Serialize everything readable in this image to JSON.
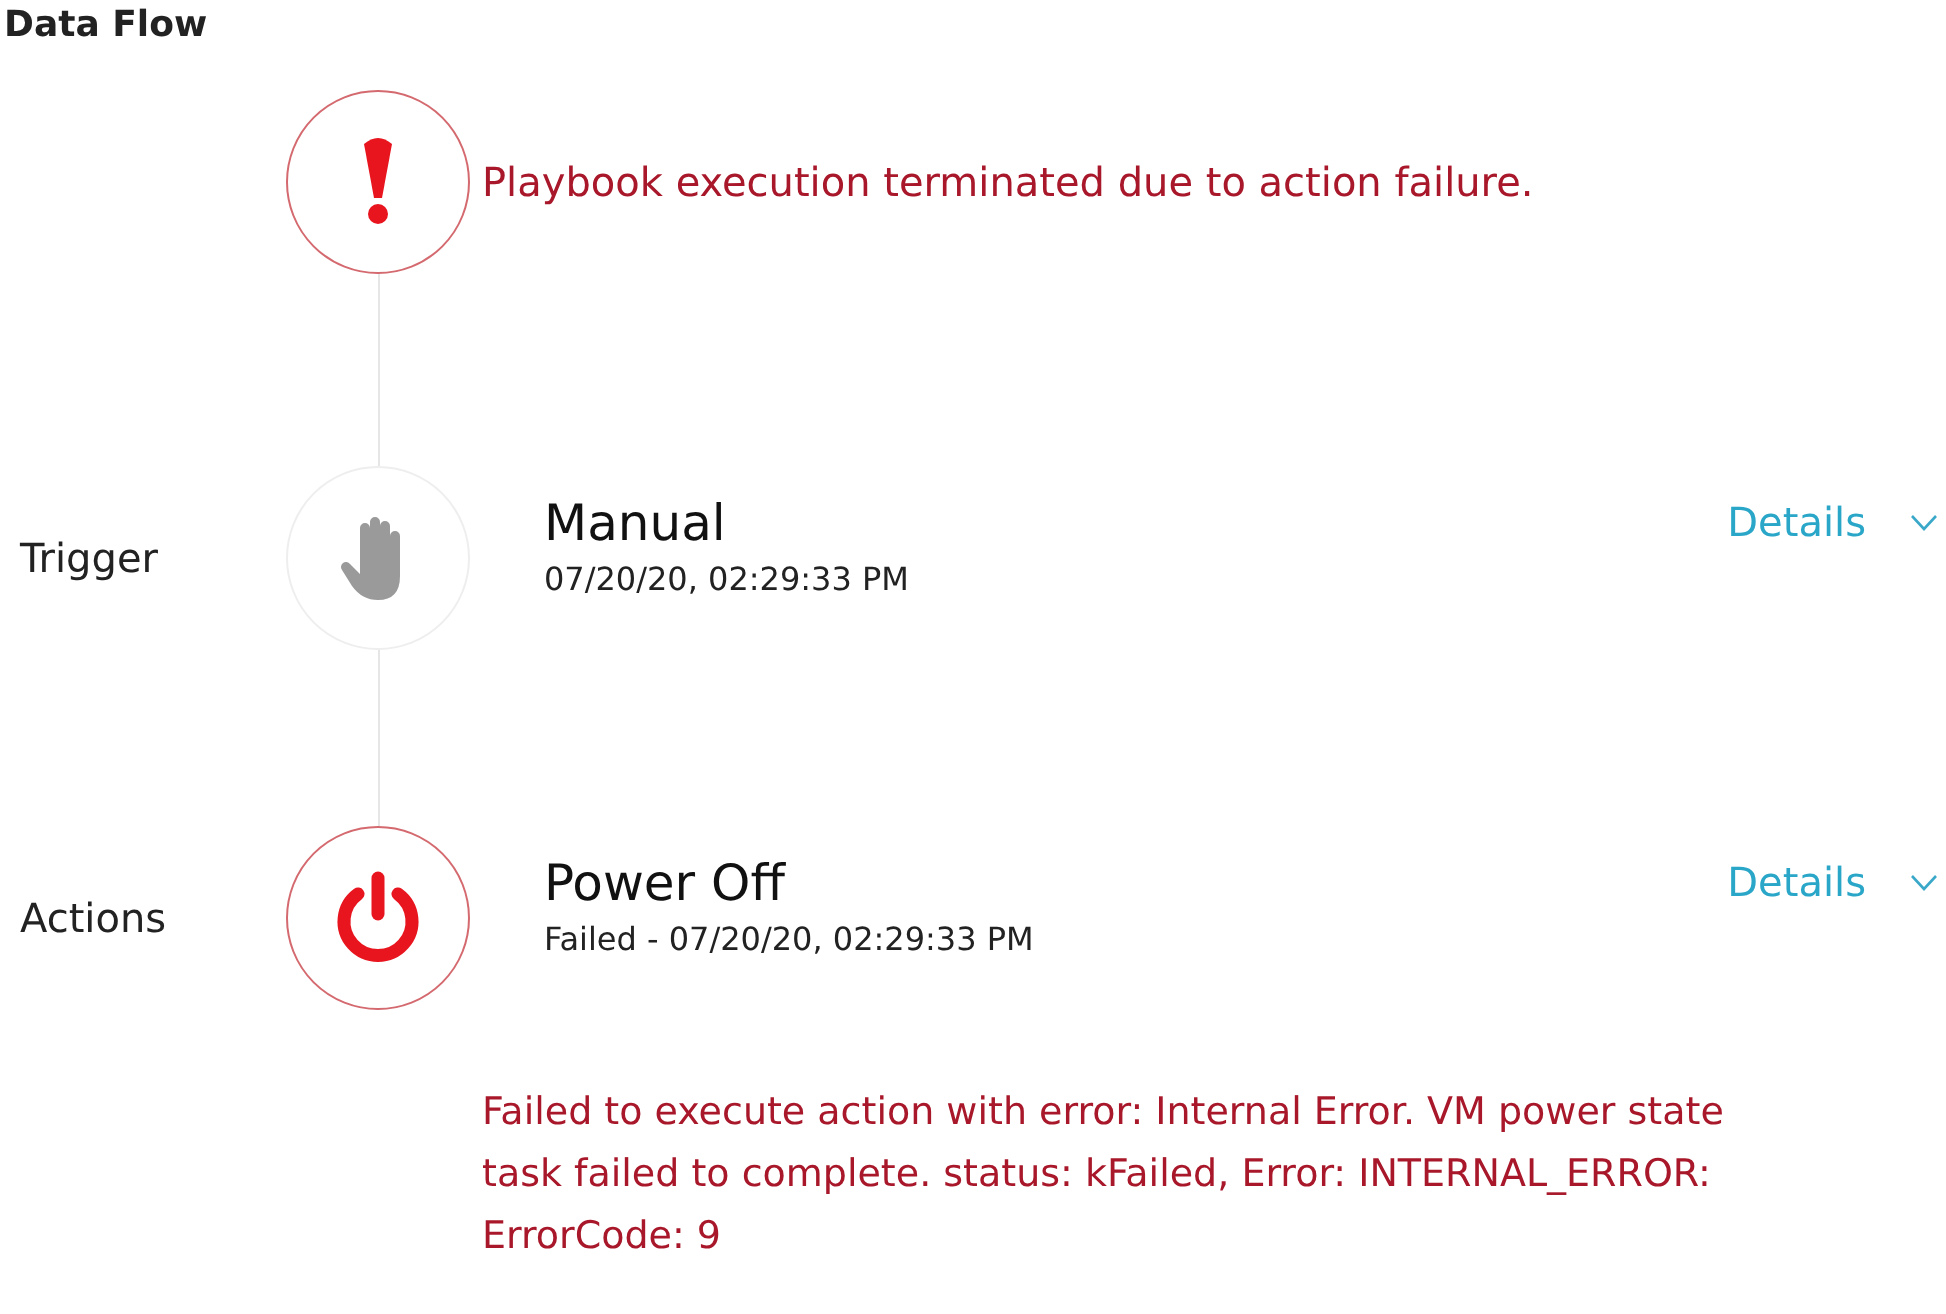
{
  "title": "Data Flow",
  "status": {
    "kind": "error",
    "message": "Playbook execution terminated due to action failure."
  },
  "steps": [
    {
      "label": "Trigger",
      "kind": "manual",
      "name": "Manual",
      "time": "07/20/20, 02:29:33 PM",
      "details": "Details",
      "expanded": false,
      "failed": false
    },
    {
      "label": "Actions",
      "kind": "power",
      "name": "Power Off",
      "time": "Failed - 07/20/20, 02:29:33 PM",
      "details": "Details",
      "expanded": false,
      "failed": true,
      "error": "Failed to execute action with error: Internal Error. VM power state task failed to complete. status: kFailed, Error: INTERNAL_ERROR: ErrorCode: 9"
    }
  ]
}
